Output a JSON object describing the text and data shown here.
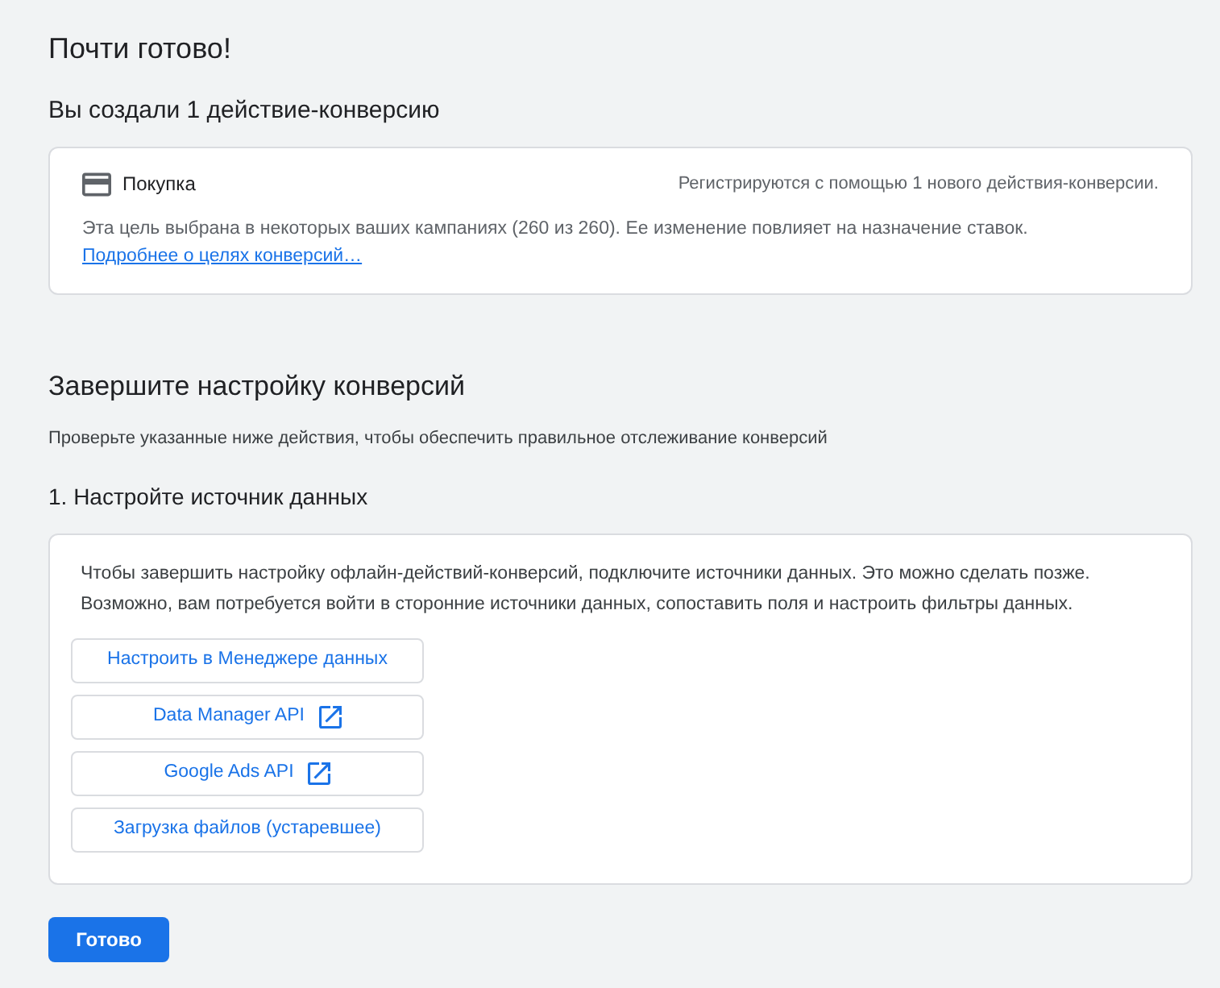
{
  "page_title": "Почти готово!",
  "created_heading": "Вы создали 1 действие-конверсию",
  "conversion_card": {
    "name": "Покупка",
    "registration_note": "Регистрируются с помощью 1 нового действия-конверсии.",
    "description": "Эта цель выбрана в некоторых ваших кампаниях (260 из 260). Ее изменение повлияет на назначение ставок.",
    "link": "Подробнее о целях конверсий…"
  },
  "setup": {
    "heading": "Завершите настройку конверсий",
    "subheading": "Проверьте указанные ниже действия, чтобы обеспечить правильное отслеживание конверсий",
    "step_heading": "1. Настройте источник данных",
    "info": "Чтобы завершить настройку офлайн-действий-конверсий, подключите источники данных. Это можно сделать позже. Возможно, вам потребуется войти в сторонние источники данных, сопоставить поля и настроить фильтры данных.",
    "buttons": [
      {
        "label": "Настроить в Менеджере данных",
        "external": false
      },
      {
        "label": "Data Manager API",
        "external": true
      },
      {
        "label": "Google Ads API",
        "external": true
      },
      {
        "label": "Загрузка файлов (устаревшее)",
        "external": false
      }
    ]
  },
  "done_button": "Готово"
}
